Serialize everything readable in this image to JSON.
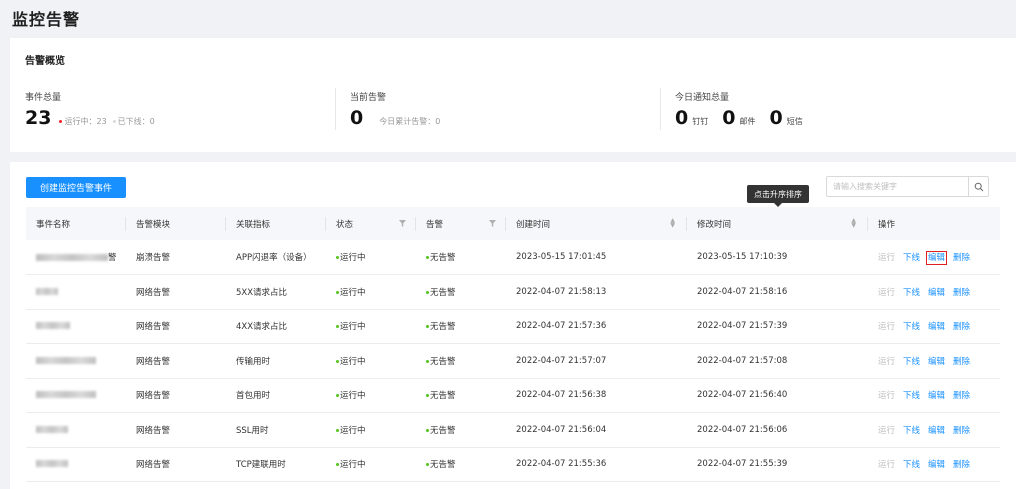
{
  "page": {
    "title": "监控告警"
  },
  "overview": {
    "title": "告警概览",
    "events": {
      "label": "事件总量",
      "total": "23",
      "running_label": "运行中：23",
      "offline_label": "已下线：0"
    },
    "alerts": {
      "label": "当前告警",
      "count": "0",
      "today_label": "今日累计告警：0"
    },
    "notify": {
      "label": "今日通知总量",
      "items": [
        {
          "count": "0",
          "unit": "钉钉"
        },
        {
          "count": "0",
          "unit": "邮件"
        },
        {
          "count": "0",
          "unit": "短信"
        }
      ]
    }
  },
  "toolbar": {
    "create_label": "创建监控告警事件",
    "search_placeholder": "请输入搜索关键字",
    "tooltip": "点击升序排序"
  },
  "table": {
    "columns": [
      "事件名称",
      "告警模块",
      "关联指标",
      "状态",
      "告警",
      "创建时间",
      "修改时间",
      "操作"
    ],
    "actions": {
      "run": "运行",
      "offline": "下线",
      "edit": "编辑",
      "delete": "删除"
    },
    "rows": [
      {
        "module": "崩溃告警",
        "metric": "APP闪退率（设备）",
        "status": "运行中",
        "alert": "无告警",
        "created": "2023-05-15 17:01:45",
        "modified": "2023-05-15 17:10:39",
        "name_suffix": "警"
      },
      {
        "module": "网络告警",
        "metric": "5XX请求占比",
        "status": "运行中",
        "alert": "无告警",
        "created": "2022-04-07 21:58:13",
        "modified": "2022-04-07 21:58:16",
        "name_suffix": ""
      },
      {
        "module": "网络告警",
        "metric": "4XX请求占比",
        "status": "运行中",
        "alert": "无告警",
        "created": "2022-04-07 21:57:36",
        "modified": "2022-04-07 21:57:39",
        "name_suffix": ""
      },
      {
        "module": "网络告警",
        "metric": "传输用时",
        "status": "运行中",
        "alert": "无告警",
        "created": "2022-04-07 21:57:07",
        "modified": "2022-04-07 21:57:08",
        "name_suffix": ""
      },
      {
        "module": "网络告警",
        "metric": "首包用时",
        "status": "运行中",
        "alert": "无告警",
        "created": "2022-04-07 21:56:38",
        "modified": "2022-04-07 21:56:40",
        "name_suffix": ""
      },
      {
        "module": "网络告警",
        "metric": "SSL用时",
        "status": "运行中",
        "alert": "无告警",
        "created": "2022-04-07 21:56:04",
        "modified": "2022-04-07 21:56:06",
        "name_suffix": ""
      },
      {
        "module": "网络告警",
        "metric": "TCP建联用时",
        "status": "运行中",
        "alert": "无告警",
        "created": "2022-04-07 21:55:36",
        "modified": "2022-04-07 21:55:39",
        "name_suffix": ""
      }
    ]
  },
  "colors": {
    "primary": "#1890ff",
    "running": "#52c41a",
    "offline": "#bfbfbf",
    "highlight": "#e02020"
  }
}
